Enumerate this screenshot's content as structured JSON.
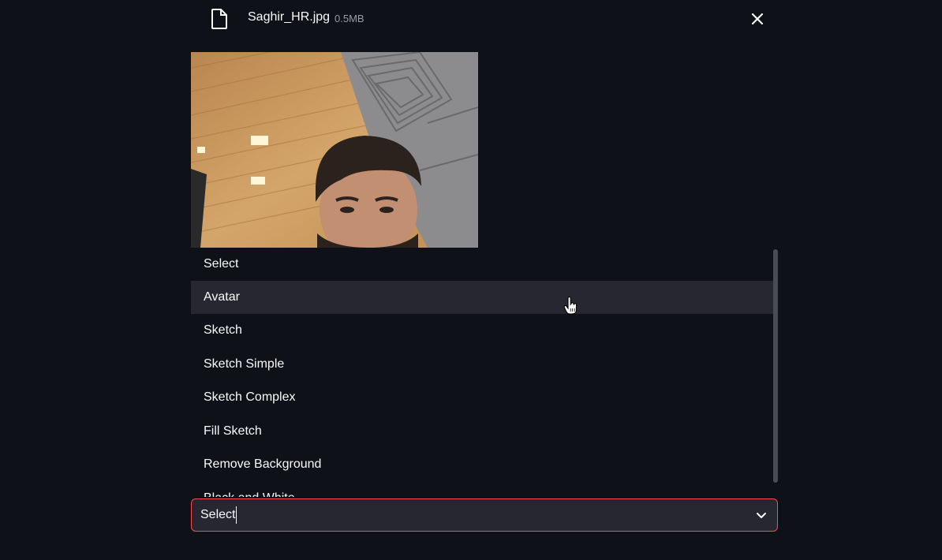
{
  "file": {
    "name": "Saghir_HR.jpg",
    "size": "0.5MB",
    "icon": "file-icon",
    "close_icon": "close-icon"
  },
  "image": {
    "alt": "Uploaded photo"
  },
  "dropdown": {
    "options": [
      "Select",
      "Avatar",
      "Sketch",
      "Sketch Simple",
      "Sketch Complex",
      "Fill Sketch",
      "Remove Background",
      "Black and White"
    ],
    "highlighted": "Avatar"
  },
  "select": {
    "value": "Select",
    "icon": "chevron-down-icon"
  },
  "colors": {
    "background": "#0e1117",
    "highlight": "#262730",
    "focus_border": "#ff4b4b"
  }
}
